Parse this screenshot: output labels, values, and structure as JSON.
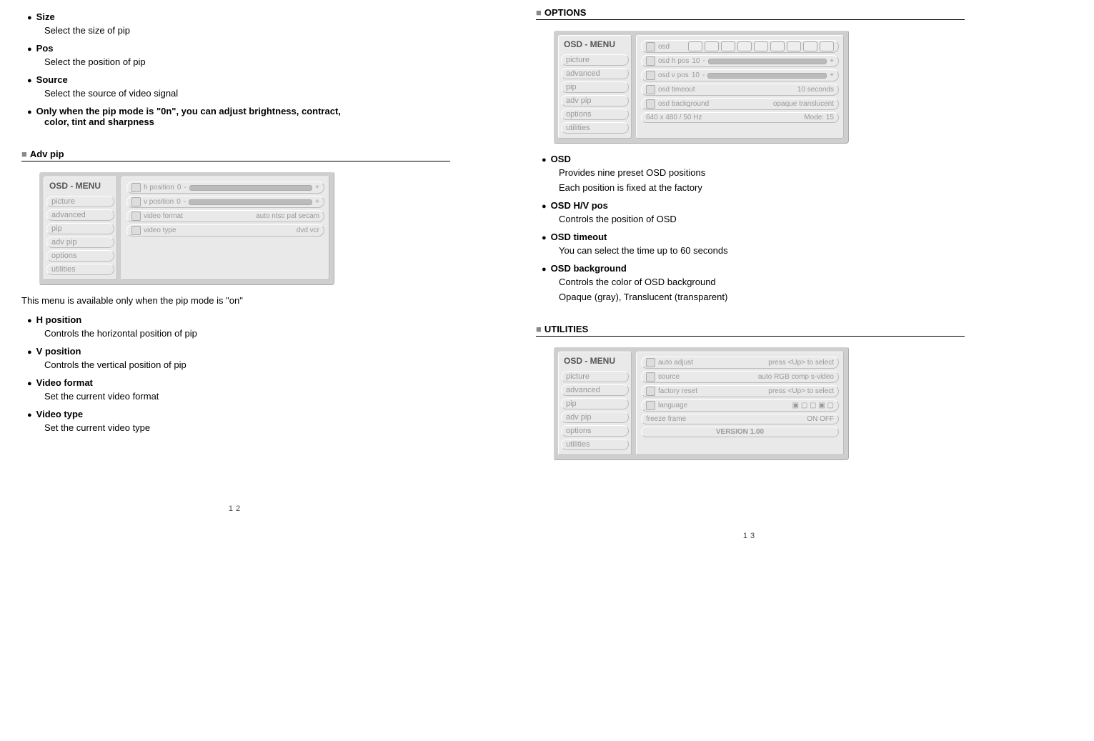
{
  "left": {
    "bullets_top": [
      {
        "title": "Size",
        "desc": "Select the size of pip"
      },
      {
        "title": "Pos",
        "desc": "Select the position of pip"
      },
      {
        "title": "Source",
        "desc": "Select the source of video signal"
      }
    ],
    "only_when_line1": "Only when the pip mode is \"0n\", you can adjust brightness, contract,",
    "only_when_line2": "color, tint and sharpness",
    "advpip_header": "Adv pip",
    "advpip_note": "This menu is available only when the pip mode is \"on\"",
    "bullets_adv": [
      {
        "title": "H position",
        "desc": "Controls the horizontal position of pip"
      },
      {
        "title": "V position",
        "desc": "Controls the vertical position of pip"
      },
      {
        "title": "Video format",
        "desc": "Set the current video format"
      },
      {
        "title": "Video type",
        "desc": "Set the current video type"
      }
    ],
    "osd_menu_title": "OSD - MENU",
    "osd_menu_items": [
      "picture",
      "advanced",
      "pip",
      "adv pip",
      "options",
      "utilities"
    ],
    "adv_rows": [
      {
        "label": "h position",
        "val": "0",
        "has_slider": true
      },
      {
        "label": "v position",
        "val": "0",
        "has_slider": true
      },
      {
        "label": "video format",
        "extra": "auto  ntsc  pal  secam"
      },
      {
        "label": "video type",
        "extra": "dvd     vcr"
      }
    ],
    "pagenum": "12"
  },
  "right": {
    "options_header": "OPTIONS",
    "options_rows": [
      {
        "label": "osd",
        "pills": 9
      },
      {
        "label": "osd h pos",
        "val": "10",
        "has_slider": true
      },
      {
        "label": "osd v pos",
        "val": "10",
        "has_slider": true
      },
      {
        "label": "osd timeout",
        "extra": "10    seconds"
      },
      {
        "label": "osd background",
        "extra": "opaque   translucent"
      }
    ],
    "options_status": "640 x 480  / 50 Hz",
    "options_mode": "Mode: 15",
    "bullets_options": [
      {
        "title": "OSD",
        "desc": "Provides nine preset OSD positions",
        "desc2": "Each position is fixed at the factory"
      },
      {
        "title": "OSD H/V pos",
        "desc": "Controls the position of OSD"
      },
      {
        "title": "OSD timeout",
        "desc": "You can select the time up to 60 seconds"
      },
      {
        "title": "OSD background",
        "desc": "Controls the color of OSD background",
        "desc2": "Opaque (gray), Translucent (transparent)"
      }
    ],
    "utilities_header": "UTILITIES",
    "utilities_rows": [
      {
        "label": "auto adjust",
        "extra": "press  <Up>  to  select"
      },
      {
        "label": "source",
        "extra": "auto   RGB   comp   s-video"
      },
      {
        "label": "factory reset",
        "extra": "press  <Up>  to  select"
      },
      {
        "label": "language",
        "extra": "▣   ▢   ▢   ▣   ▢"
      },
      {
        "label": "freeze frame",
        "extra": "ON              OFF"
      }
    ],
    "utilities_version": "VERSION  1.00",
    "pagenum": "13"
  }
}
